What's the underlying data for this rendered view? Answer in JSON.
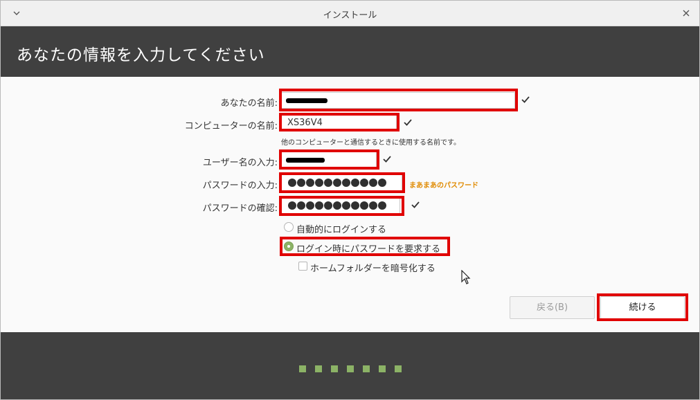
{
  "window": {
    "title": "インストール"
  },
  "header": {
    "heading": "あなたの情報を入力してください"
  },
  "form": {
    "name_label": "あなたの名前:",
    "computer_label": "コンピューターの名前:",
    "computer_value": "XS36V4",
    "computer_hint": "他のコンピューターと通信するときに使用する名前です。",
    "username_label": "ユーザー名の入力:",
    "password_label": "パスワードの入力:",
    "password_strength": "まあまあのパスワード",
    "confirm_label": "パスワードの確認:",
    "password_dot_count": 11
  },
  "login": {
    "auto_login_label": "自動的にログインする",
    "require_password_label": "ログイン時にパスワードを要求する",
    "encrypt_home_label": "ホームフォルダーを暗号化する",
    "selected": "require_password"
  },
  "buttons": {
    "back_label": "戻る(B)",
    "continue_label": "続ける"
  },
  "progress": {
    "steps": 7
  },
  "colors": {
    "header_bg": "#404040",
    "accent_green": "#8cb366",
    "highlight_red": "#e00000",
    "strength_orange": "#e08a00"
  },
  "icons": {
    "window_menu": "chevron-down-icon",
    "close": "close-icon",
    "valid": "checkmark-icon",
    "pointer": "mouse-pointer-icon"
  }
}
